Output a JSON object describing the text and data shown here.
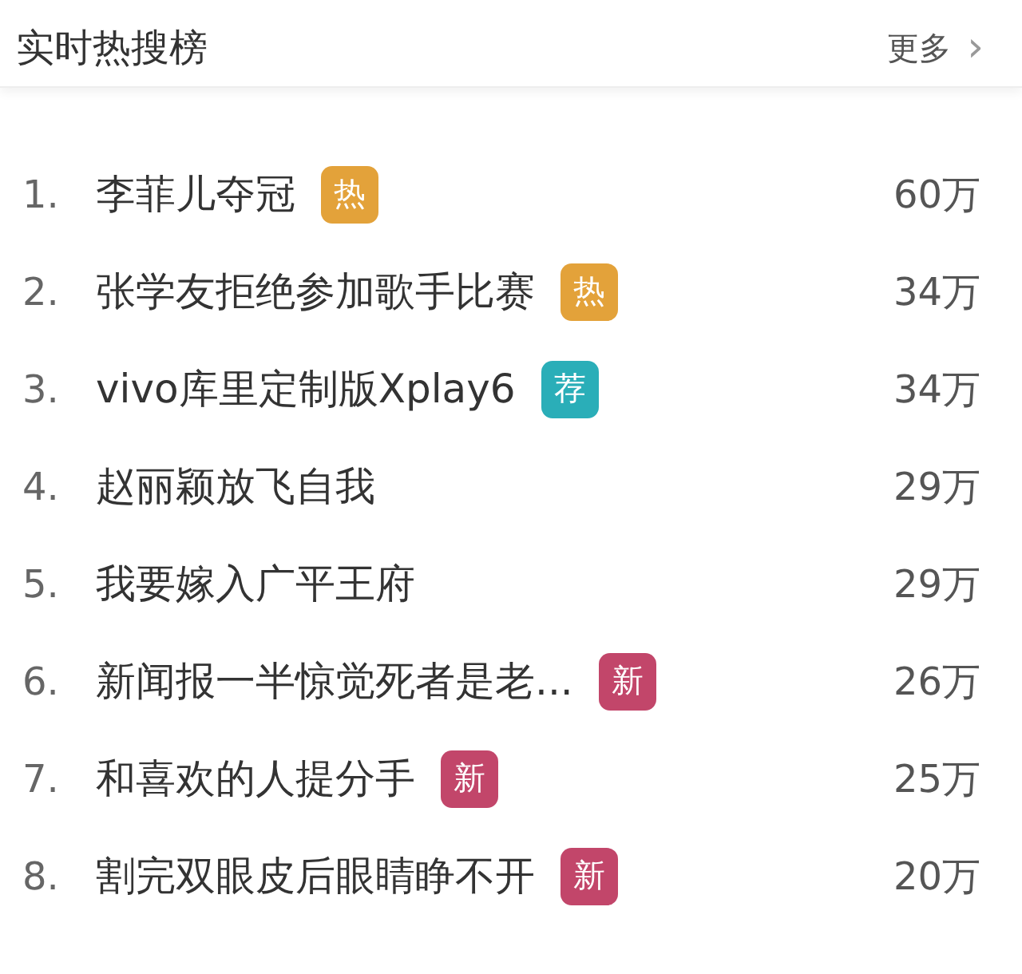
{
  "header": {
    "title": "实时热搜榜",
    "more": "更多",
    "more_arrow": "›"
  },
  "items": [
    {
      "rank": "1.",
      "title": "李菲儿夺冠",
      "badge": {
        "text": "热",
        "color": "#e3a23a"
      },
      "count": "60万"
    },
    {
      "rank": "2.",
      "title": "张学友拒绝参加歌手比赛",
      "badge": {
        "text": "热",
        "color": "#e3a23a"
      },
      "count": "34万"
    },
    {
      "rank": "3.",
      "title": "vivo库里定制版Xplay6",
      "badge": {
        "text": "荐",
        "color": "#2aaeb8"
      },
      "count": "34万"
    },
    {
      "rank": "4.",
      "title": "赵丽颖放飞自我",
      "count": "29万"
    },
    {
      "rank": "5.",
      "title": "我要嫁入广平王府",
      "count": "29万"
    },
    {
      "rank": "6.",
      "title": "新闻报一半惊觉死者是老...",
      "badge": {
        "text": "新",
        "color": "#c2466a"
      },
      "count": "26万"
    },
    {
      "rank": "7.",
      "title": "和喜欢的人提分手",
      "badge": {
        "text": "新",
        "color": "#c2466a"
      },
      "count": "25万"
    },
    {
      "rank": "8.",
      "title": "割完双眼皮后眼睛睁不开",
      "badge": {
        "text": "新",
        "color": "#c2466a"
      },
      "count": "20万"
    }
  ]
}
